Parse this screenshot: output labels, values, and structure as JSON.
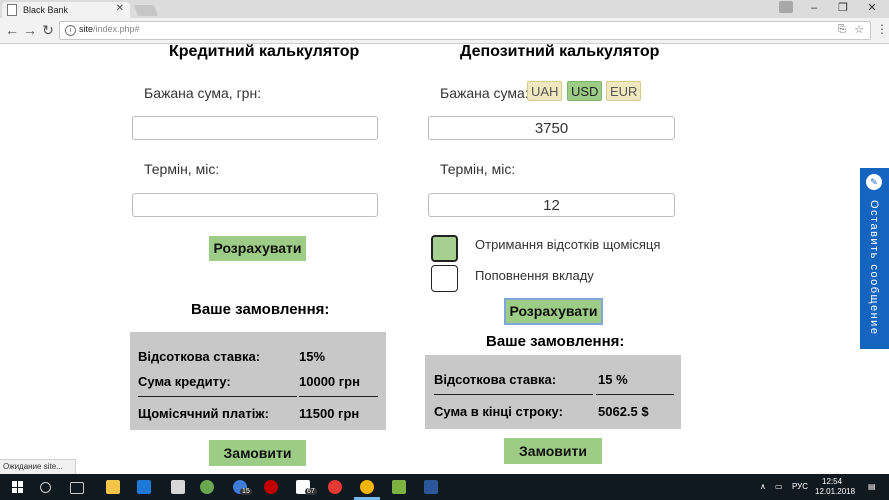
{
  "browser": {
    "tab_title": "Black Bank",
    "tab_close": "✕",
    "url_host": "site",
    "url_path": "/index.php#",
    "win_minimize": "–",
    "win_maximize": "❐",
    "win_close": "✕"
  },
  "credit": {
    "title": "Кредитний калькулятор",
    "amount_label": "Бажана сума, грн:",
    "amount_value": "",
    "term_label": "Термін, міс:",
    "term_value": "",
    "calc_button": "Розрахувати",
    "order_title": "Ваше замовлення:",
    "order_rows": [
      {
        "key": "Відсоткова ставка:",
        "value": "15%"
      },
      {
        "key": "Сума кредиту:",
        "value": "10000 грн"
      },
      {
        "key": "Щомісячний платіж:",
        "value": "11500 грн"
      }
    ],
    "order_button": "Замовити"
  },
  "deposit": {
    "title": "Депозитний калькулятор",
    "amount_label": "Бажана сума:",
    "currencies": [
      "UAH",
      "USD",
      "EUR"
    ],
    "active_currency": "USD",
    "amount_value": "3750",
    "term_label": "Термін, міс:",
    "term_value": "12",
    "checkbox_monthly": {
      "label": "Отримання відсотків щомісяця",
      "checked": true
    },
    "checkbox_topup": {
      "label": "Поповнення вкладу",
      "checked": false
    },
    "calc_button": "Розрахувати",
    "order_title": "Ваше замовлення:",
    "order_rows": [
      {
        "key": "Відсоткова ставка:",
        "value": "15 %"
      },
      {
        "key": "Сума в кінці строку:",
        "value": "5062.5 $"
      }
    ],
    "order_button": "Замовити"
  },
  "side_widget": {
    "label": "Оставить сообщение"
  },
  "status_text": "Ожидание site...",
  "taskbar": {
    "lang": "РУС",
    "time": "12:54",
    "date": "12.01.2018",
    "badge_1": "15",
    "badge_2": "67"
  },
  "colors": {
    "accent_green": "#9ccc85",
    "currency_inactive": "#f2e8c0",
    "order_bg": "#c8c8c8",
    "widget_blue": "#1565c0"
  }
}
